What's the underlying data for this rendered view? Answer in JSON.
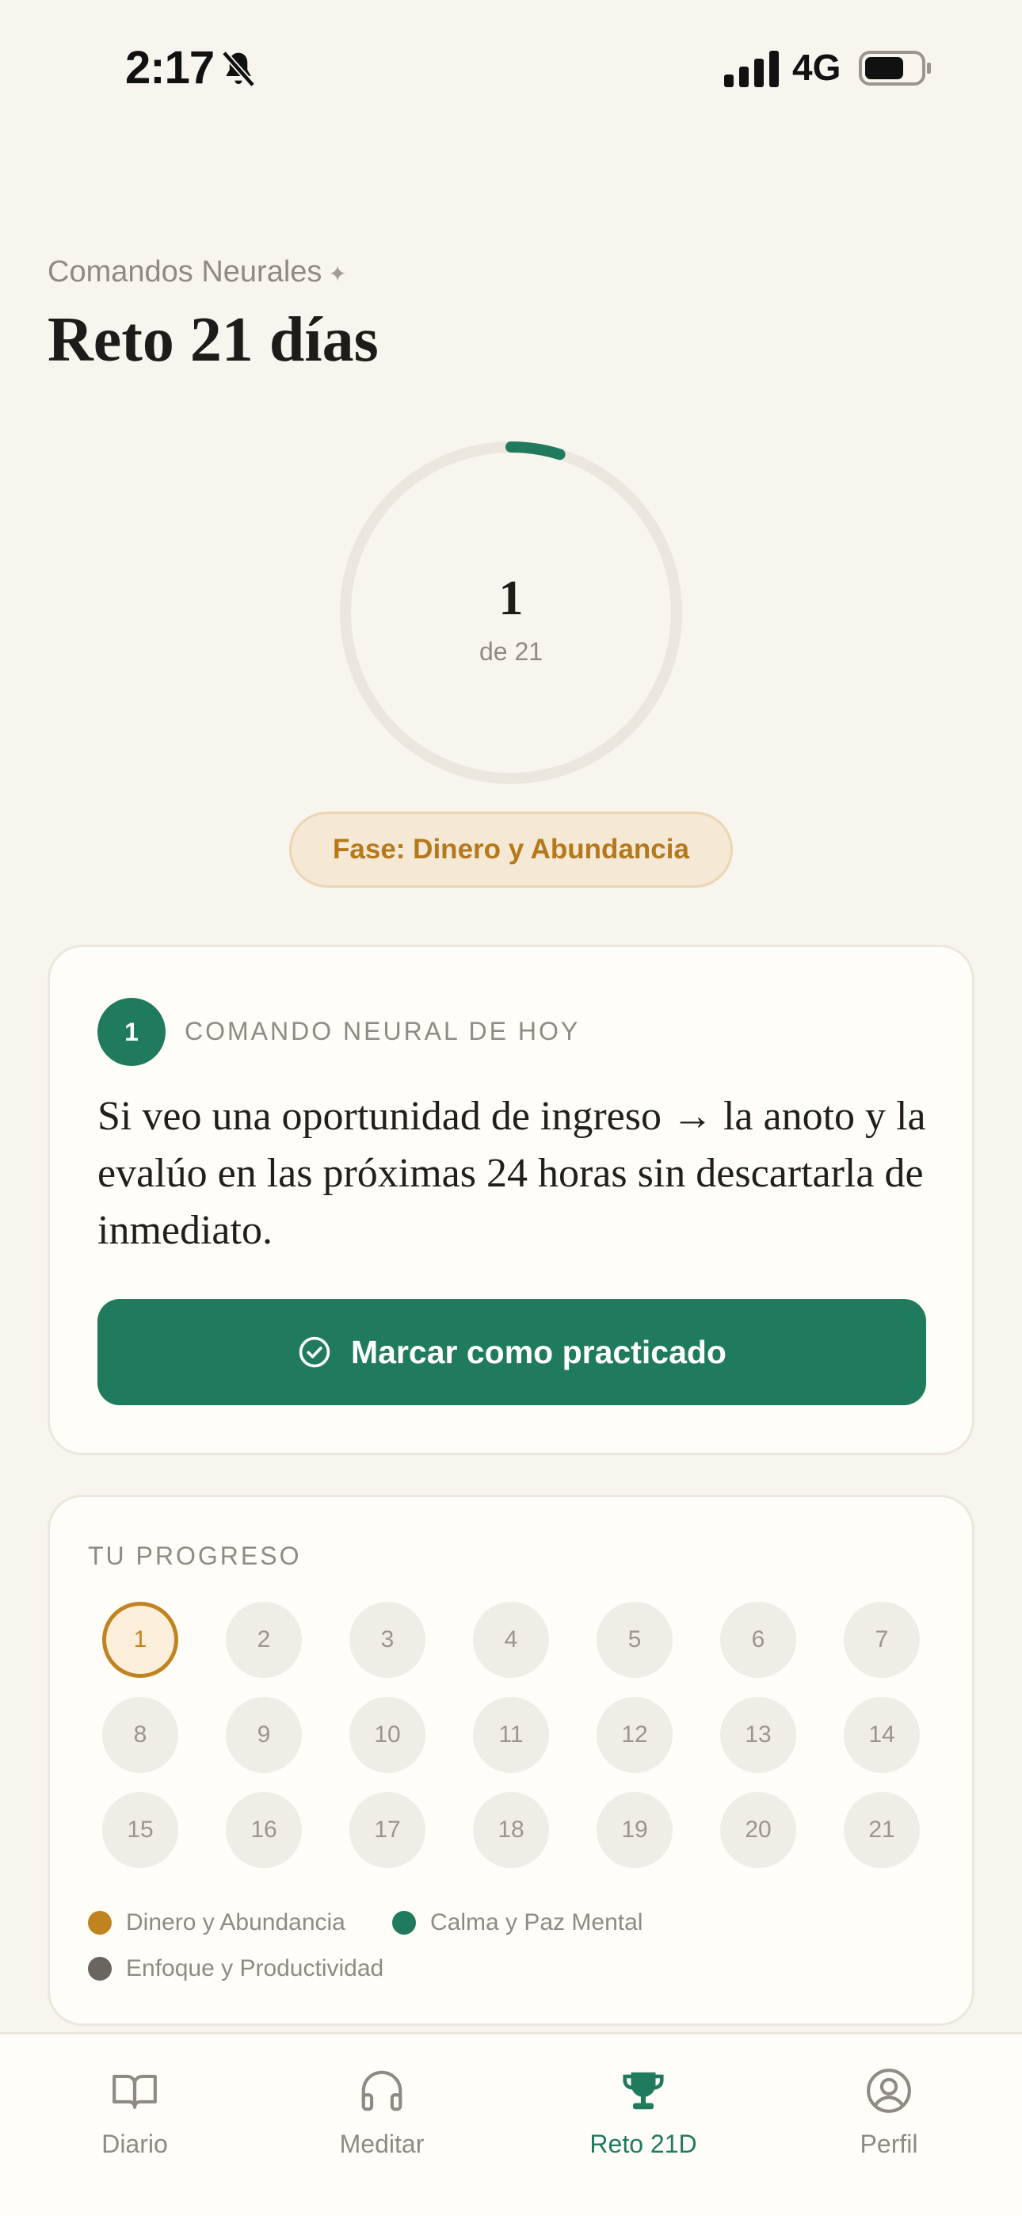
{
  "status_bar": {
    "time": "2:17",
    "network": "4G"
  },
  "header": {
    "eyebrow": "Comandos Neurales",
    "title": "Reto 21 días"
  },
  "progress_ring": {
    "current_day": "1",
    "total_label": "de 21",
    "progress_fraction": 0.0476
  },
  "phase": {
    "label": "Fase: Dinero y Abundancia"
  },
  "today_card": {
    "badge": "1",
    "label": "COMANDO NEURAL DE HOY",
    "command": "Si veo una oportunidad de ingreso → la anoto y la evalúo en las próximas 24 horas sin descartarla de inmediato.",
    "button_label": "Marcar como practicado"
  },
  "progress_card": {
    "label": "TU PROGRESO",
    "days": [
      "1",
      "2",
      "3",
      "4",
      "5",
      "6",
      "7",
      "8",
      "9",
      "10",
      "11",
      "12",
      "13",
      "14",
      "15",
      "16",
      "17",
      "18",
      "19",
      "20",
      "21"
    ],
    "current_day_index": 0,
    "legend": [
      {
        "label": "Dinero y Abundancia",
        "color": "#c0831f"
      },
      {
        "label": "Calma y Paz Mental",
        "color": "#207a5e"
      },
      {
        "label": "Enfoque y Productividad",
        "color": "#6b6560"
      }
    ]
  },
  "tabbar": {
    "tabs": [
      {
        "label": "Diario",
        "icon": "book-icon"
      },
      {
        "label": "Meditar",
        "icon": "headphones-icon"
      },
      {
        "label": "Reto 21D",
        "icon": "trophy-icon"
      },
      {
        "label": "Perfil",
        "icon": "user-circle-icon"
      }
    ],
    "active_index": 2
  },
  "colors": {
    "accent": "#207a5e",
    "phase": "#c0831f",
    "background": "#f8f5ee"
  }
}
